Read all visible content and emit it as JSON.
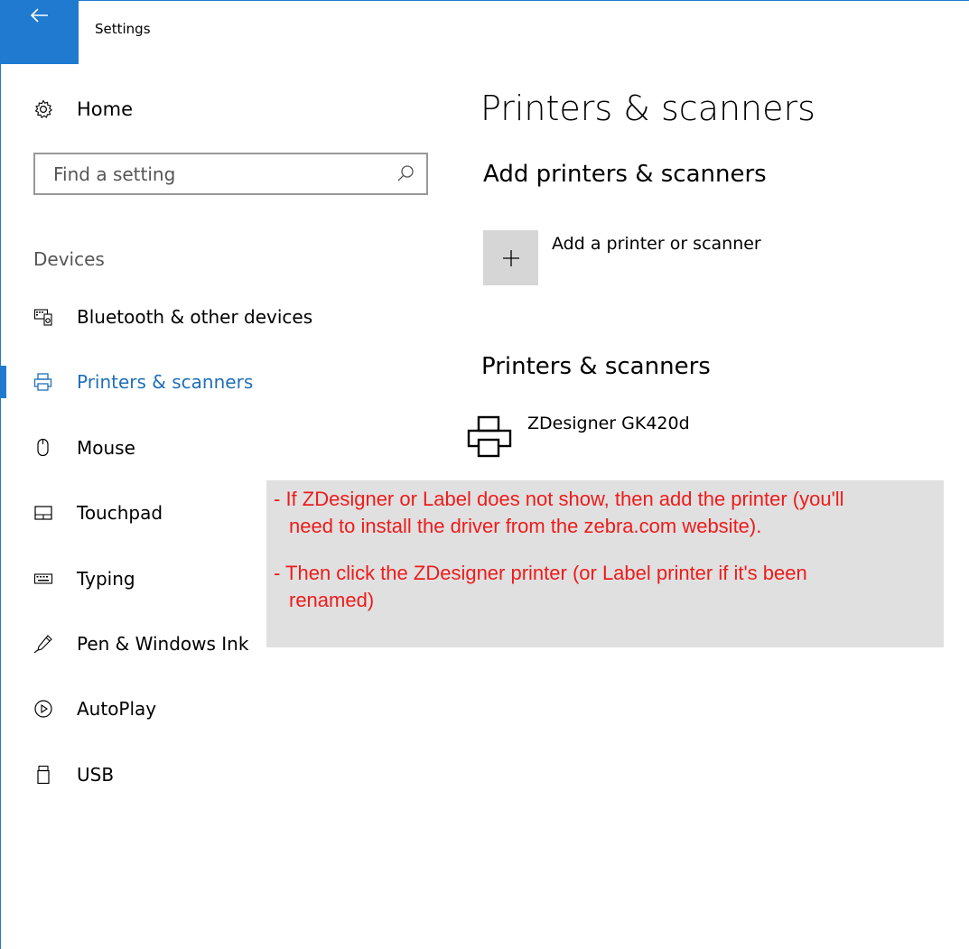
{
  "window": {
    "title": "Settings"
  },
  "sidebar": {
    "home_label": "Home",
    "search_placeholder": "Find a setting",
    "section_label": "Devices",
    "items": [
      {
        "label": "Bluetooth & other devices",
        "icon": "bluetooth-devices-icon",
        "active": false
      },
      {
        "label": "Printers & scanners",
        "icon": "printer-icon",
        "active": true
      },
      {
        "label": "Mouse",
        "icon": "mouse-icon",
        "active": false
      },
      {
        "label": "Touchpad",
        "icon": "touchpad-icon",
        "active": false
      },
      {
        "label": "Typing",
        "icon": "keyboard-icon",
        "active": false
      },
      {
        "label": "Pen & Windows Ink",
        "icon": "pen-icon",
        "active": false
      },
      {
        "label": "AutoPlay",
        "icon": "autoplay-icon",
        "active": false
      },
      {
        "label": "USB",
        "icon": "usb-icon",
        "active": false
      }
    ]
  },
  "main": {
    "page_title": "Printers & scanners",
    "add_section_heading": "Add printers & scanners",
    "add_button_label": "Add a printer or scanner",
    "list_heading": "Printers & scanners",
    "printers": [
      {
        "name": "ZDesigner GK420d"
      }
    ]
  },
  "annotation": {
    "line1a": "- If ZDesigner or Label does not show, then add the printer (you'll",
    "line1b": "need to install the driver from the zebra.com website).",
    "line2a": "- Then click the ZDesigner printer (or Label printer if it's been",
    "line2b": "renamed)"
  },
  "colors": {
    "accent": "#1f7ad0",
    "annotation_text": "#ee1b1b",
    "annotation_bg": "#e0e0e0",
    "add_tile_bg": "#d6d6d6"
  }
}
